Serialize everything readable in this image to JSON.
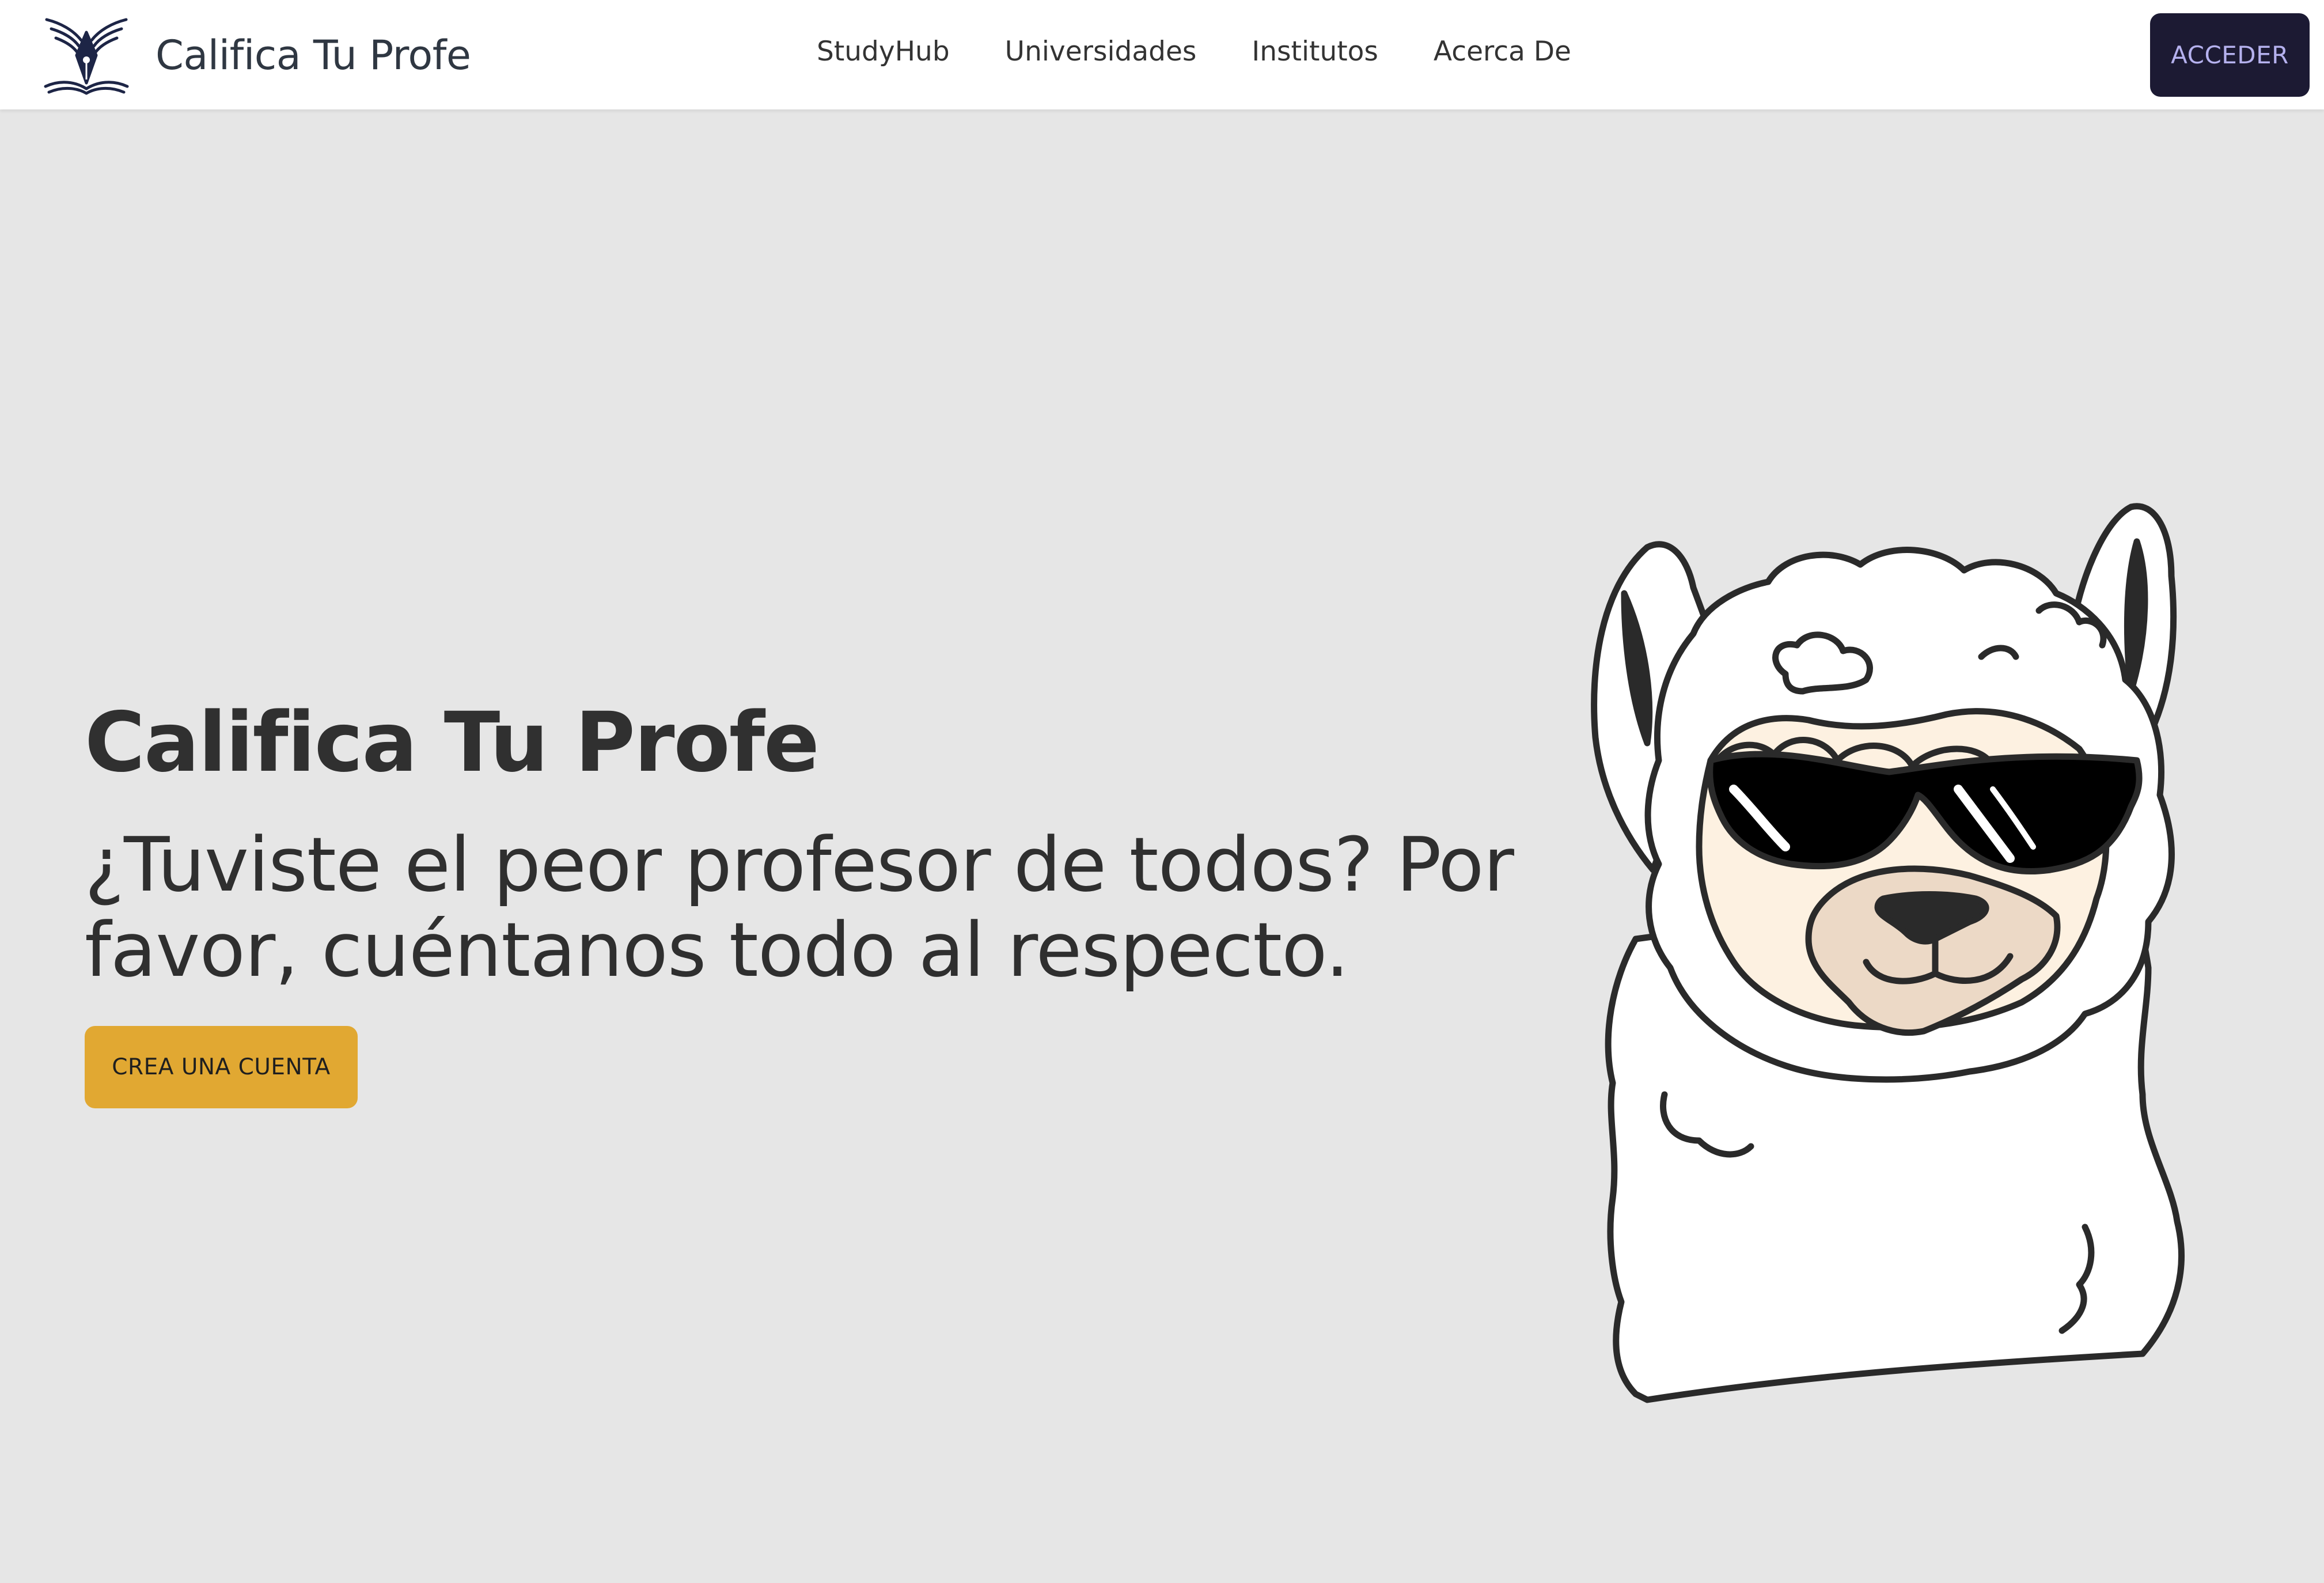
{
  "navbar": {
    "brand_name": "Califica Tu Profe",
    "logo_icon": "pen-nib-wings-book-logo",
    "links": [
      {
        "label": "StudyHub"
      },
      {
        "label": "Universidades"
      },
      {
        "label": "Institutos"
      },
      {
        "label": "Acerca De"
      }
    ],
    "login_label": "ACCEDER"
  },
  "hero": {
    "title": "Califica Tu Profe",
    "subtitle": "¿Tuviste el peor profesor de todos? Por favor, cuéntanos todo al respecto.",
    "cta_label": "CREA UNA CUENTA",
    "illustration_icon": "llama-with-sunglasses-illustration"
  },
  "colors": {
    "page_background": "#e6e6e6",
    "navbar_background": "#ffffff",
    "login_button": "#1c1a33",
    "login_text": "#b5b1ee",
    "cta_button": "#e1a832",
    "logo": "#1d2546"
  }
}
